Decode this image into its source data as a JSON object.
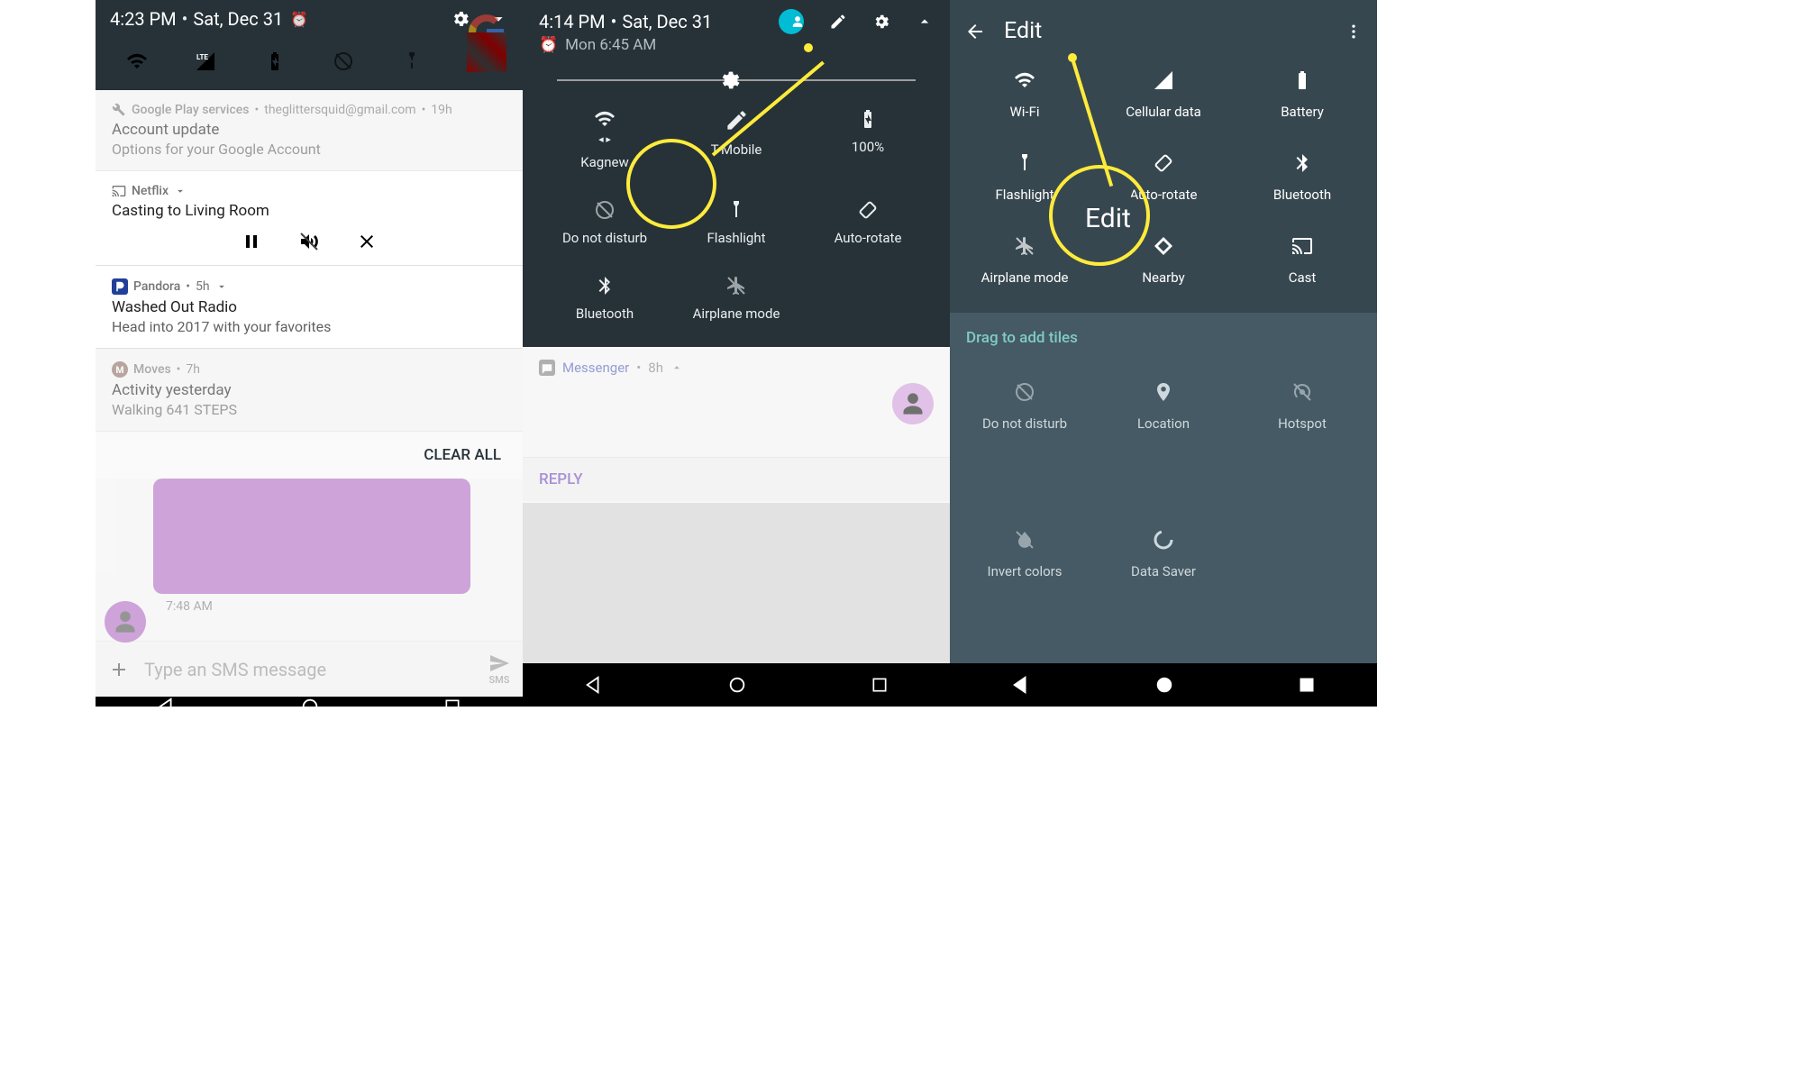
{
  "panel1": {
    "time": "4:23 PM",
    "date": "Sat, Dec 31",
    "notifications": [
      {
        "icon": "wrench",
        "app": "Google Play services",
        "extra": "theglittersquid@gmail.com",
        "age": "19h",
        "title": "Account update",
        "sub": "Options for your Google Account"
      },
      {
        "icon": "cast",
        "app": "Netflix",
        "title": "Casting to Living Room"
      },
      {
        "icon": "pandora",
        "app": "Pandora",
        "age": "5h",
        "title": "Washed Out Radio",
        "sub": "Head into 2017 with your favorites"
      },
      {
        "icon": "moves",
        "app": "Moves",
        "age": "7h",
        "title": "Activity yesterday",
        "sub": "Walking 641 STEPS"
      }
    ],
    "clear_all": "CLEAR ALL",
    "sms_time": "7:48 AM",
    "sms_placeholder": "Type an SMS message",
    "sms_send": "SMS"
  },
  "panel2": {
    "time": "4:14 PM",
    "date": "Sat, Dec 31",
    "alarm": "Mon 6:45 AM",
    "tiles": [
      {
        "label": "Kagnew"
      },
      {
        "label": "T-Mobile"
      },
      {
        "label": "100%"
      },
      {
        "label": "Do not disturb"
      },
      {
        "label": "Flashlight"
      },
      {
        "label": "Auto-rotate"
      },
      {
        "label": "Bluetooth"
      },
      {
        "label": "Airplane mode"
      }
    ],
    "messenger": {
      "app": "Messenger",
      "age": "8h",
      "reply": "REPLY"
    }
  },
  "panel3": {
    "title": "Edit",
    "tiles": [
      "Wi-Fi",
      "Cellular data",
      "Battery",
      "Flashlight",
      "Auto-rotate",
      "Bluetooth",
      "Airplane mode",
      "Nearby",
      "Cast"
    ],
    "drag_label": "Drag to add tiles",
    "available": [
      "Do not disturb",
      "Location",
      "Hotspot",
      "Invert colors",
      "Data Saver"
    ],
    "highlight_label": "Edit"
  }
}
